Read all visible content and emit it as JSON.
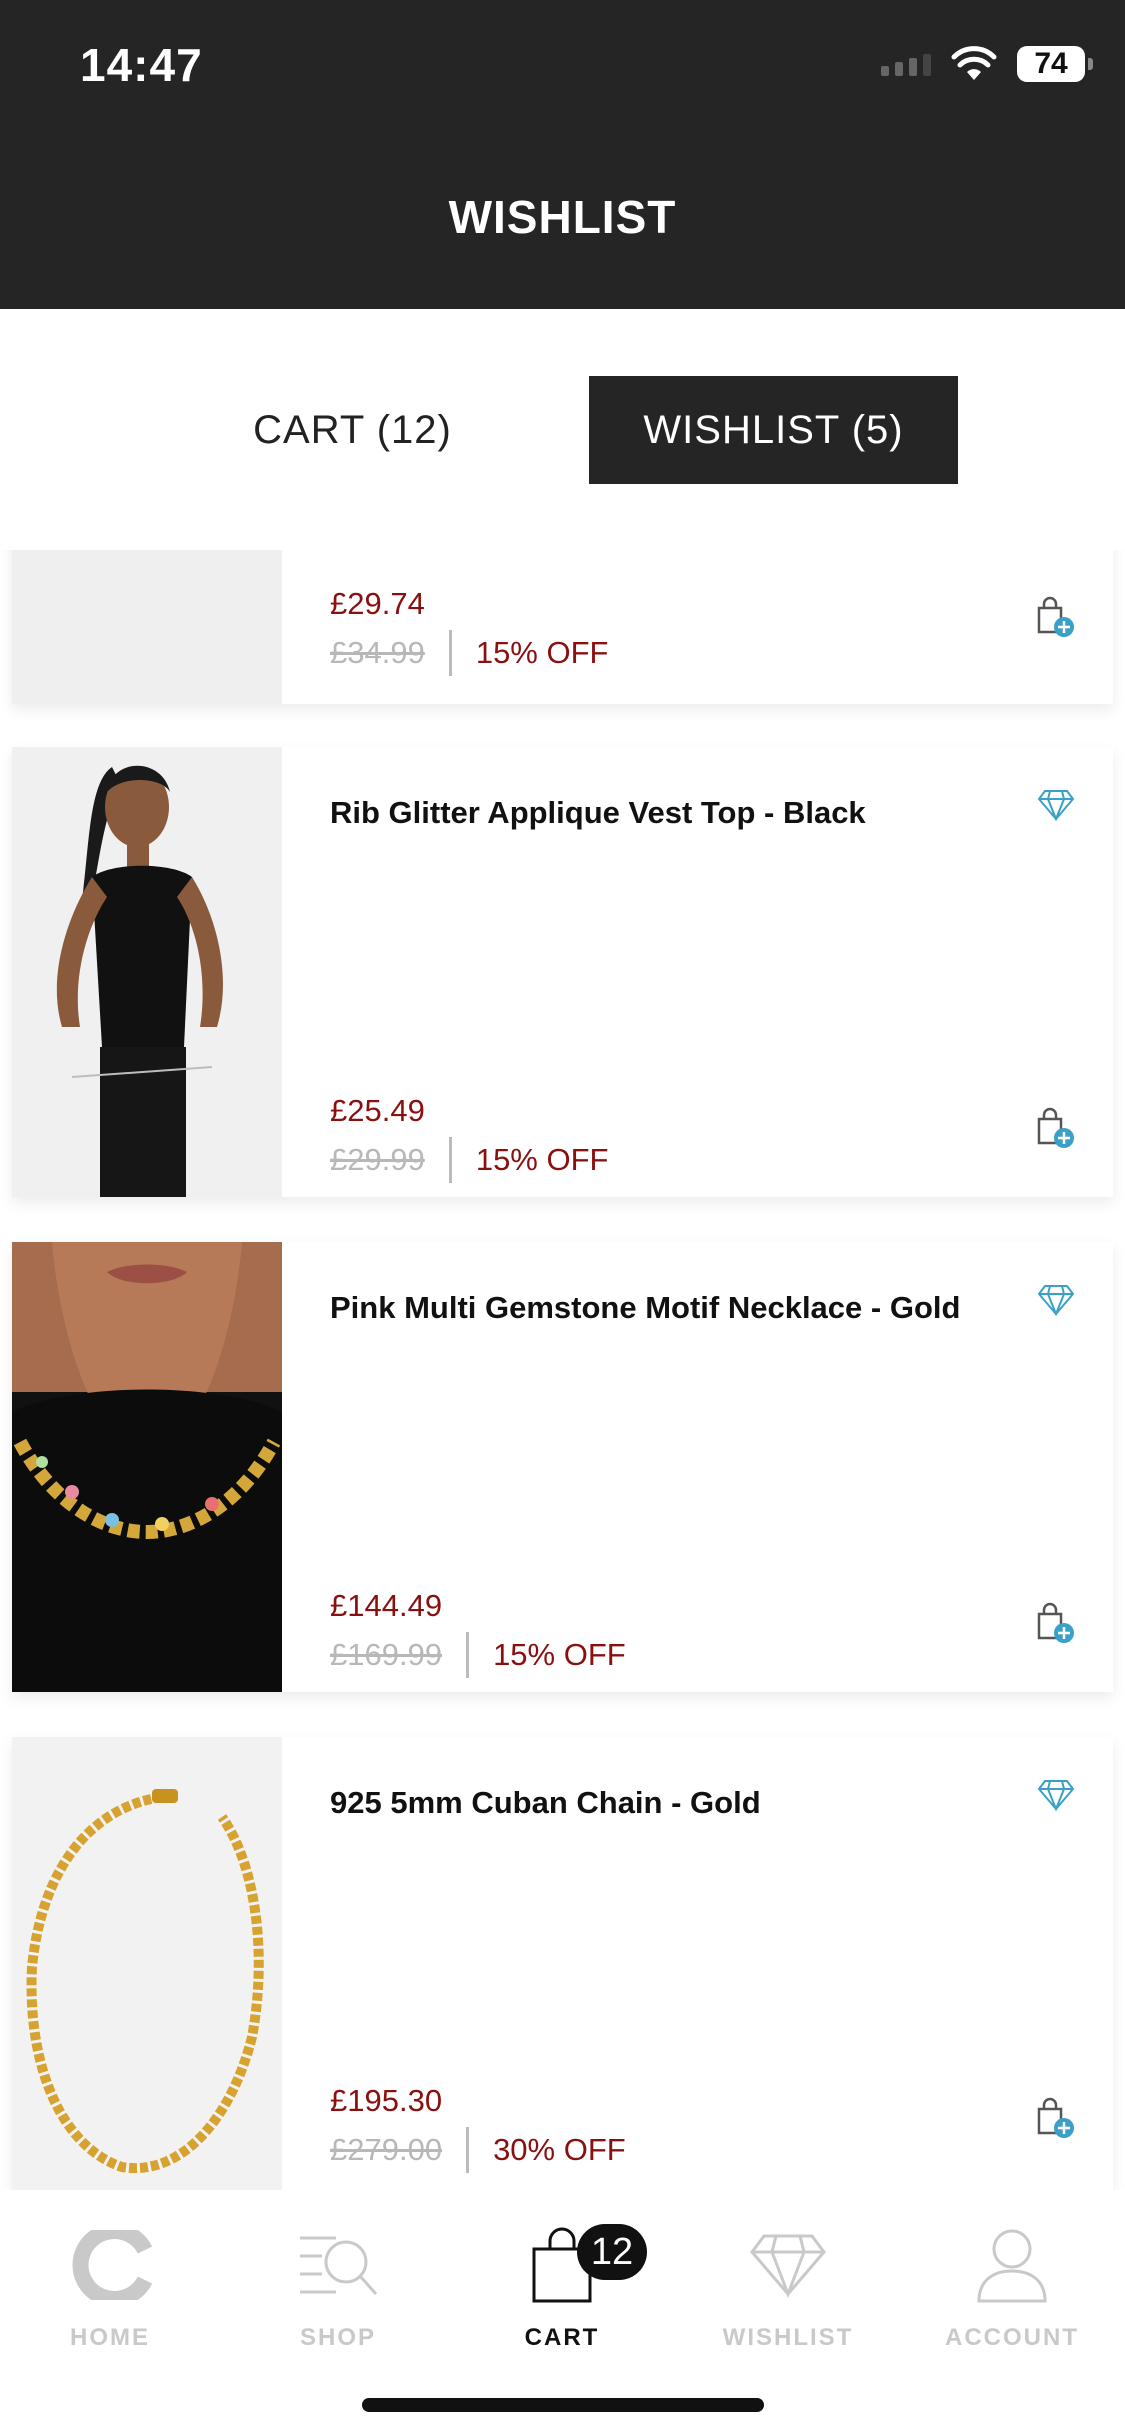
{
  "status_bar": {
    "time": "14:47",
    "battery": "74"
  },
  "header": {
    "title": "WISHLIST"
  },
  "tabs": {
    "cart": "CART (12)",
    "wishlist": "WISHLIST (5)"
  },
  "items": [
    {
      "title": "",
      "price": "£29.74",
      "old_price": "£34.99",
      "discount": "15% OFF"
    },
    {
      "title": "Rib Glitter Applique Vest Top - Black",
      "price": "£25.49",
      "old_price": "£29.99",
      "discount": "15% OFF"
    },
    {
      "title": "Pink Multi Gemstone Motif Necklace - Gold",
      "price": "£144.49",
      "old_price": "£169.99",
      "discount": "15% OFF"
    },
    {
      "title": "925 5mm Cuban Chain - Gold",
      "price": "£195.30",
      "old_price": "£279.00",
      "discount": "30% OFF"
    }
  ],
  "bottom_nav": {
    "home": "HOME",
    "shop": "SHOP",
    "cart": "CART",
    "cart_badge": "12",
    "wishlist": "WISHLIST",
    "account": "ACCOUNT"
  },
  "colors": {
    "header_bg": "#252525",
    "price_red": "#8a1010",
    "accent_blue": "#3aa0c8"
  }
}
